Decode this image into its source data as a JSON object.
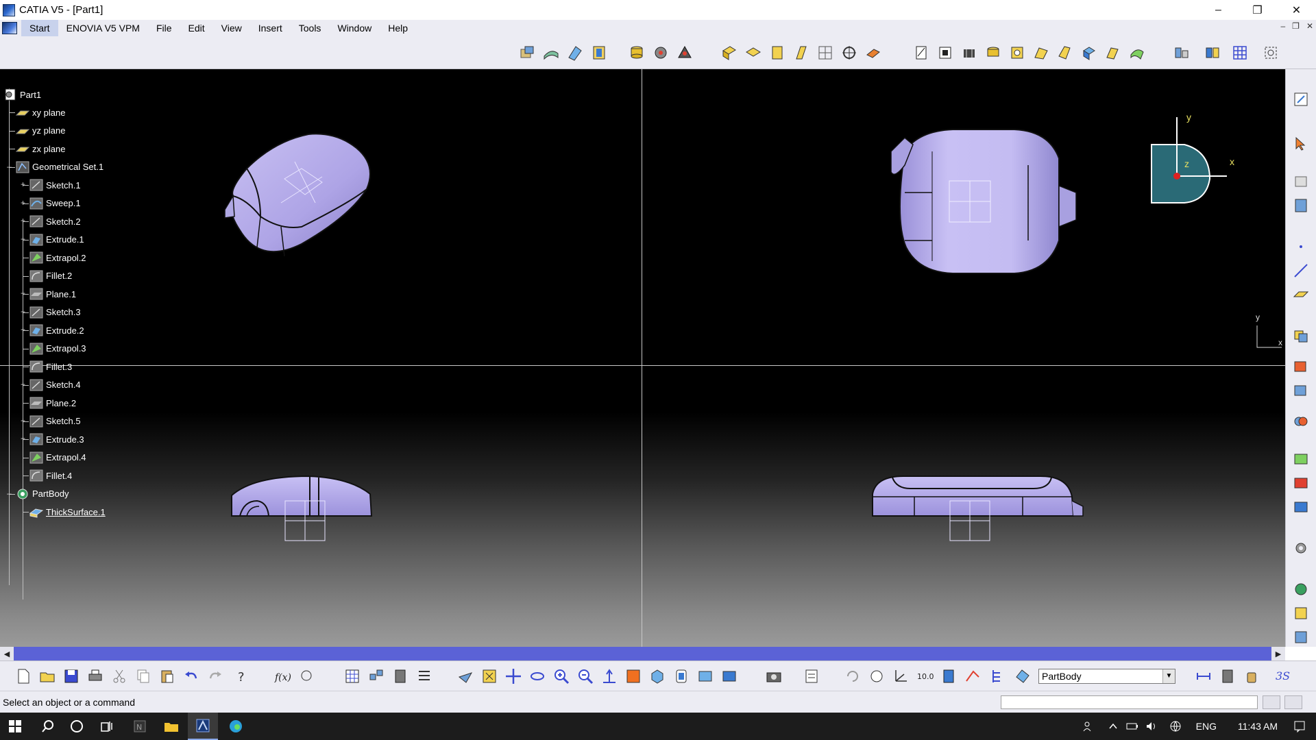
{
  "window": {
    "title": "CATIA V5 - [Part1]",
    "minimize": "–",
    "maximize": "❐",
    "close": "✕"
  },
  "menu": {
    "items": [
      "Start",
      "ENOVIA V5 VPM",
      "File",
      "Edit",
      "View",
      "Insert",
      "Tools",
      "Window",
      "Help"
    ]
  },
  "tree": {
    "root": "Part1",
    "nodes": [
      {
        "label": "xy plane",
        "icon": "plane-icon"
      },
      {
        "label": "yz plane",
        "icon": "plane-icon"
      },
      {
        "label": "zx plane",
        "icon": "plane-icon"
      },
      {
        "label": "Geometrical Set.1",
        "icon": "geometrical-set-icon"
      },
      {
        "label": "Sketch.1",
        "icon": "sketch-icon"
      },
      {
        "label": "Sweep.1",
        "icon": "sweep-icon"
      },
      {
        "label": "Sketch.2",
        "icon": "sketch-icon"
      },
      {
        "label": "Extrude.1",
        "icon": "extrude-icon"
      },
      {
        "label": "Extrapol.2",
        "icon": "extrapolate-icon"
      },
      {
        "label": "Fillet.2",
        "icon": "fillet-icon"
      },
      {
        "label": "Plane.1",
        "icon": "plane-feature-icon"
      },
      {
        "label": "Sketch.3",
        "icon": "sketch-icon"
      },
      {
        "label": "Extrude.2",
        "icon": "extrude-icon"
      },
      {
        "label": "Extrapol.3",
        "icon": "extrapolate-icon"
      },
      {
        "label": "Fillet.3",
        "icon": "fillet-icon"
      },
      {
        "label": "Sketch.4",
        "icon": "sketch-icon"
      },
      {
        "label": "Plane.2",
        "icon": "plane-feature-icon"
      },
      {
        "label": "Sketch.5",
        "icon": "sketch-icon"
      },
      {
        "label": "Extrude.3",
        "icon": "extrude-icon"
      },
      {
        "label": "Extrapol.4",
        "icon": "extrapolate-icon"
      },
      {
        "label": "Fillet.4",
        "icon": "fillet-icon"
      },
      {
        "label": "PartBody",
        "icon": "partbody-icon"
      },
      {
        "label": "ThickSurface.1",
        "icon": "thick-surface-icon"
      }
    ]
  },
  "compass": {
    "y": "y",
    "x": "x",
    "z": "z"
  },
  "axis_small": {
    "y": "y",
    "x": "x"
  },
  "current_body": "PartBody",
  "status": {
    "message": "Select an object or a command"
  },
  "taskbar": {
    "language": "ENG",
    "time": "11:43 AM"
  },
  "colors": {
    "part": "#b8b0ea",
    "viewport_bg": "#000000",
    "scrollbar": "#5b62d6",
    "toolbar": "#ececf3"
  }
}
